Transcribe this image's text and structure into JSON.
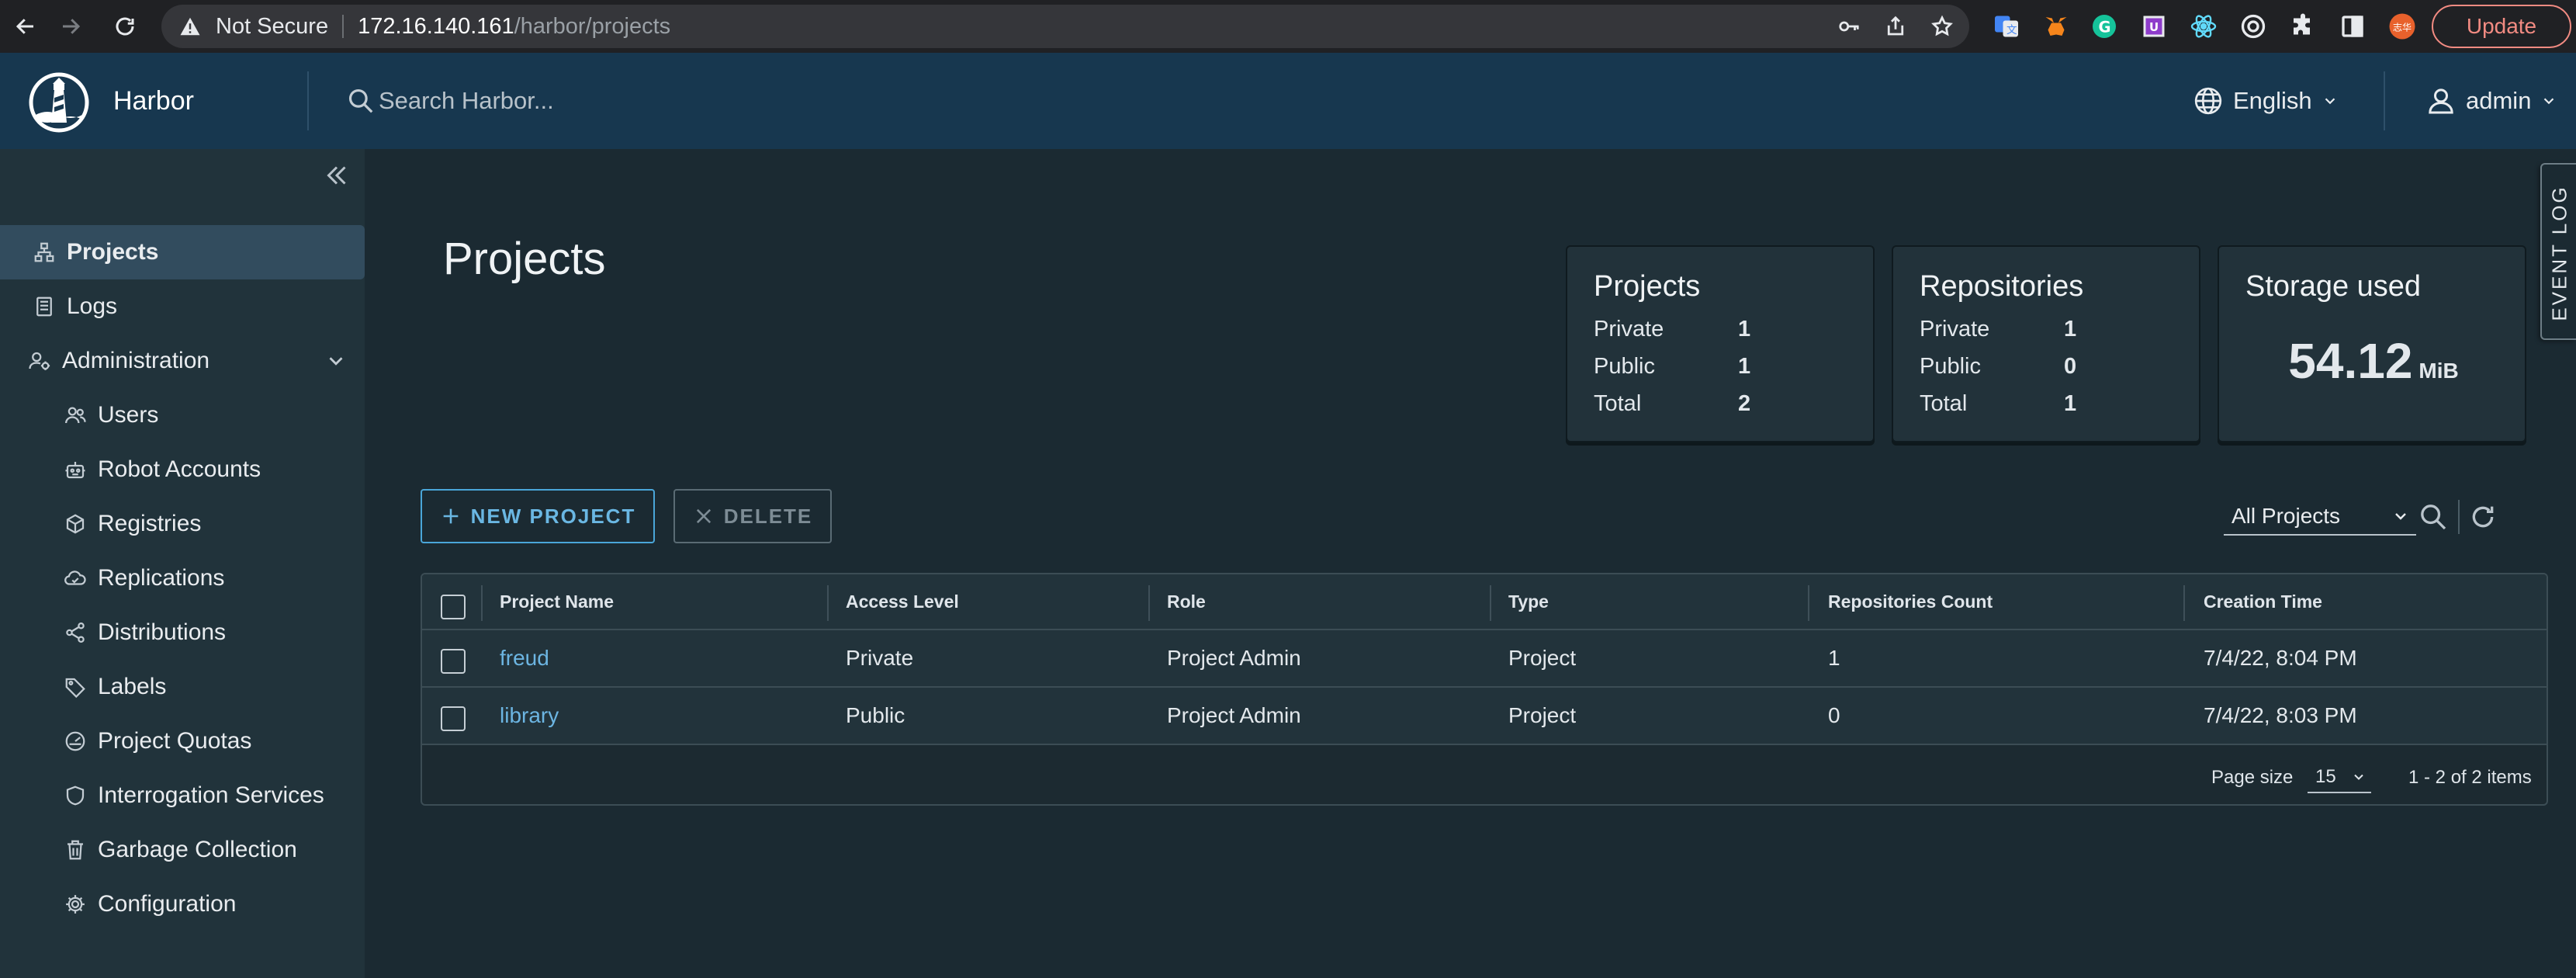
{
  "browser": {
    "security_label": "Not Secure",
    "url_host": "172.16.140.161",
    "url_path": "/harbor/projects",
    "update_label": "Update",
    "profile_initials": "志华"
  },
  "header": {
    "brand": "Harbor",
    "search_placeholder": "Search Harbor...",
    "language": "English",
    "user": "admin"
  },
  "sidebar": {
    "items": [
      {
        "label": "Projects"
      },
      {
        "label": "Logs"
      },
      {
        "label": "Administration"
      },
      {
        "label": "Users"
      },
      {
        "label": "Robot Accounts"
      },
      {
        "label": "Registries"
      },
      {
        "label": "Replications"
      },
      {
        "label": "Distributions"
      },
      {
        "label": "Labels"
      },
      {
        "label": "Project Quotas"
      },
      {
        "label": "Interrogation Services"
      },
      {
        "label": "Garbage Collection"
      },
      {
        "label": "Configuration"
      }
    ]
  },
  "main": {
    "title": "Projects",
    "cards": {
      "projects": {
        "title": "Projects",
        "private_label": "Private",
        "private": "1",
        "public_label": "Public",
        "public": "1",
        "total_label": "Total",
        "total": "2"
      },
      "repositories": {
        "title": "Repositories",
        "private_label": "Private",
        "private": "1",
        "public_label": "Public",
        "public": "0",
        "total_label": "Total",
        "total": "1"
      },
      "storage": {
        "title": "Storage used",
        "value": "54.12",
        "unit": "MiB"
      }
    },
    "new_project_label": "NEW PROJECT",
    "delete_label": "DELETE",
    "filter_selected": "All Projects",
    "event_log_label": "EVENT LOG"
  },
  "table": {
    "columns": [
      "Project Name",
      "Access Level",
      "Role",
      "Type",
      "Repositories Count",
      "Creation Time"
    ],
    "rows": [
      {
        "name": "freud",
        "access": "Private",
        "role": "Project Admin",
        "type": "Project",
        "repo_count": "1",
        "created": "7/4/22, 8:04 PM"
      },
      {
        "name": "library",
        "access": "Public",
        "role": "Project Admin",
        "type": "Project",
        "repo_count": "0",
        "created": "7/4/22, 8:03 PM"
      }
    ],
    "footer": {
      "page_size_label": "Page size",
      "page_size": "15",
      "count": "1 - 2 of 2 items"
    }
  },
  "colors": {
    "header_bg": "#17374f",
    "sidebar_bg": "#21333b",
    "content_bg": "#1b2a32",
    "accent": "#4aa6d9",
    "link": "#6cb5e2"
  }
}
